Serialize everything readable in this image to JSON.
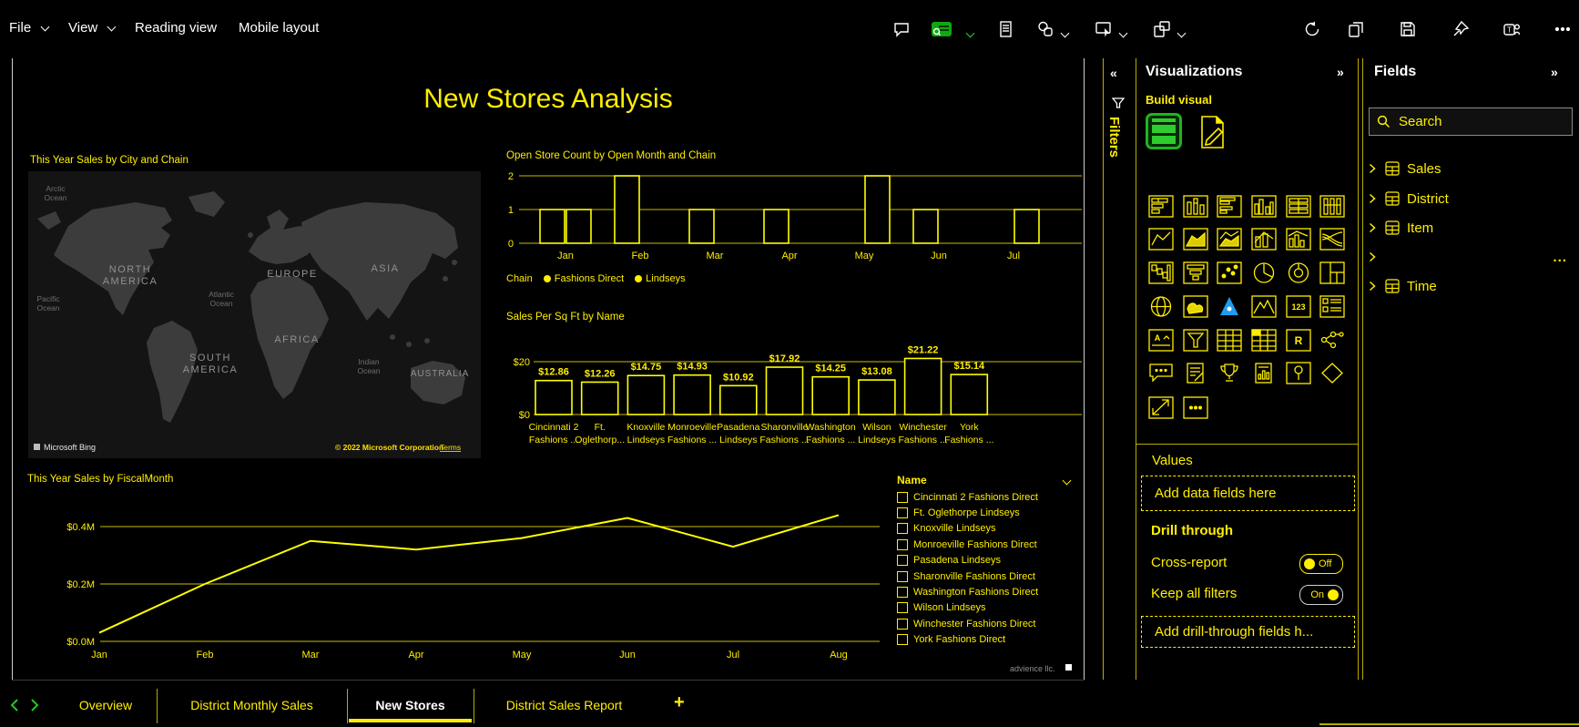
{
  "window": {
    "menu": {
      "items": [
        {
          "label": "File",
          "caret": true
        },
        {
          "label": "View",
          "caret": true
        },
        {
          "label": "Reading view",
          "caret": false
        },
        {
          "label": "Mobile layout",
          "caret": false
        }
      ]
    },
    "toolbar": {
      "icons": [
        "comment",
        "reading-view",
        "notes",
        "copy-visual",
        "visual-interactions",
        "open-new-window",
        "refresh",
        "duplicate",
        "save",
        "pin",
        "teams",
        "more-options"
      ]
    }
  },
  "canvas": {
    "title": "New Stores Analysis",
    "corner_note": "advience llc."
  },
  "map_visual": {
    "title": "This Year Sales by City and Chain",
    "continents": [
      {
        "text": "NORTH AMERICA",
        "two_line": true
      },
      {
        "text": "SOUTH AMERICA",
        "two_line": true
      },
      {
        "text": "EUROPE",
        "two_line": false
      },
      {
        "text": "AFRICA",
        "two_line": false
      },
      {
        "text": "ASIA",
        "two_line": false
      },
      {
        "text": "AUSTRALIA",
        "two_line": false
      }
    ],
    "oceans": [
      {
        "text": "Arctic Ocean"
      },
      {
        "text": "Pacific Ocean"
      },
      {
        "text": "Atlantic Ocean"
      },
      {
        "text": "Indian Ocean"
      }
    ],
    "bing_label": "Microsoft Bing",
    "copyright": "© 2022 Microsoft Corporation",
    "terms_label": "Terms"
  },
  "chart_data": [
    {
      "id": "open-store-count",
      "type": "bar",
      "title": "Open Store Count by Open Month and Chain",
      "categories": [
        "Jan",
        "Feb",
        "Mar",
        "Apr",
        "May",
        "Jun",
        "Jul"
      ],
      "series": [
        {
          "name": "Fashions Direct",
          "values": [
            1,
            2,
            1,
            1,
            0,
            1,
            0
          ]
        },
        {
          "name": "Lindseys",
          "values": [
            1,
            0,
            0,
            0,
            2,
            0,
            1
          ]
        }
      ],
      "ylim": [
        0,
        2
      ],
      "yticks_top_to_bottom": [
        "2",
        "1",
        "0"
      ],
      "legend_title": "Chain",
      "legend_position": "bottom",
      "grid": true
    },
    {
      "id": "sales-per-sqft",
      "type": "bar",
      "title": "Sales Per Sq Ft by Name",
      "categories": [
        [
          "Cincinnati 2",
          "Fashions ..."
        ],
        [
          "Ft.",
          "Oglethorp..."
        ],
        [
          "Knoxville",
          "Lindseys"
        ],
        [
          "Monroeville",
          "Fashions ..."
        ],
        [
          "Pasadena",
          "Lindseys"
        ],
        [
          "Sharonville",
          "Fashions ..."
        ],
        [
          "Washington",
          "Fashions ..."
        ],
        [
          "Wilson",
          "Lindseys"
        ],
        [
          "Winchester",
          "Fashions ..."
        ],
        [
          "York",
          "Fashions ..."
        ]
      ],
      "values": [
        12.86,
        12.26,
        14.75,
        14.93,
        10.92,
        17.92,
        14.25,
        13.08,
        21.22,
        15.14
      ],
      "data_labels": [
        "$12.86",
        "$12.26",
        "$14.75",
        "$14.93",
        "$10.92",
        "$17.92",
        "$14.25",
        "$13.08",
        "$21.22",
        "$15.14"
      ],
      "ylim": [
        0,
        20
      ],
      "yticks_top_to_bottom": [
        "$20",
        "$0"
      ],
      "grid": true
    },
    {
      "id": "ty-sales-by-fiscalmonth",
      "type": "line",
      "title": "This Year Sales by FiscalMonth",
      "x": [
        "Jan",
        "Feb",
        "Mar",
        "Apr",
        "May",
        "Jun",
        "Jul",
        "Aug"
      ],
      "values_musd": [
        0.03,
        0.2,
        0.35,
        0.32,
        0.36,
        0.43,
        0.33,
        0.44
      ],
      "ylim_musd": [
        0,
        0.45
      ],
      "yticks_top_to_bottom": [
        "$0.4M",
        "$0.2M",
        "$0.0M"
      ],
      "grid": true
    }
  ],
  "slicer": {
    "header": "Name",
    "items": [
      "Cincinnati 2 Fashions Direct",
      "Ft. Oglethorpe Lindseys",
      "Knoxville Lindseys",
      "Monroeville Fashions Direct",
      "Pasadena Lindseys",
      "Sharonville Fashions Direct",
      "Washington Fashions Direct",
      "Wilson Lindseys",
      "Winchester Fashions Direct",
      "York Fashions Direct"
    ],
    "all_unchecked": true
  },
  "filters_rail": {
    "collapse_glyph": "«",
    "label": "Filters"
  },
  "viz_panel": {
    "header": "Visualizations",
    "expand_glyph": "»",
    "build_label": "Build visual",
    "icon_rows": [
      [
        "bar-st",
        "col-st",
        "bar-cl",
        "col-cl",
        "bar-100",
        "col-100"
      ],
      [
        "line",
        "area",
        "area-st",
        "combo",
        "combo2",
        "ribbon"
      ],
      [
        "waterfall",
        "funnel",
        "scatter",
        "pie",
        "donut",
        "treemap"
      ],
      [
        "globe",
        "filled-map",
        "azure-map",
        "shape-map",
        "card-123",
        "multi-card"
      ],
      [
        "kpi",
        "slicer",
        "table",
        "matrix",
        "r-script",
        "decomp-tree"
      ],
      [
        "qa",
        "narrative",
        "trophy",
        "paginated",
        "pin-map",
        "diamond"
      ],
      [
        "automate",
        "more"
      ]
    ],
    "values_label": "Values",
    "values_placeholder": "Add data fields here",
    "drill_label": "Drill through",
    "cross_report": {
      "label": "Cross-report",
      "state": "Off"
    },
    "keep_filters": {
      "label": "Keep all filters",
      "state": "On"
    },
    "drill_placeholder": "Add drill-through fields h..."
  },
  "fields_panel": {
    "header": "Fields",
    "expand_glyph": "»",
    "search_placeholder": "Search",
    "rows": [
      {
        "label": "Sales",
        "icon": true,
        "more": false
      },
      {
        "label": "District",
        "icon": true,
        "more": false
      },
      {
        "label": "Item",
        "icon": true,
        "more": false
      },
      {
        "label": "",
        "icon": false,
        "more": true
      },
      {
        "label": "Time",
        "icon": true,
        "more": false
      }
    ],
    "more_glyph": "..."
  },
  "tab_bar": {
    "tabs": [
      {
        "label": "Overview",
        "selected": false
      },
      {
        "label": "District Monthly Sales",
        "selected": false
      },
      {
        "label": "New Stores",
        "selected": true
      },
      {
        "label": "District Sales Report",
        "selected": false
      }
    ],
    "add_label": "+"
  },
  "colors": {
    "text_yellow": "#ffee00",
    "chart_yellow": "#ffff00",
    "grid_yellow": "#c8bd00",
    "menu_green": "#11a811",
    "nav_green": "#22c922",
    "selected_white": "#ffffff",
    "map_land": "#3c3c3c",
    "map_bg": "#141414",
    "azure_blue": "#1f9cf0"
  }
}
